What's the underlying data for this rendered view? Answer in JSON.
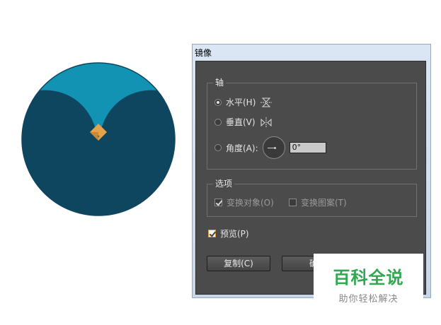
{
  "dialog": {
    "title": "镜像",
    "axis_group": {
      "label": "轴",
      "horizontal": "水平(H)",
      "vertical": "垂直(V)",
      "angle": "角度(A):",
      "angle_value": "0°",
      "selected": "horizontal"
    },
    "options_group": {
      "label": "选项",
      "transform_objects": "变换对象(O)",
      "transform_patterns": "变换图案(T)",
      "transform_objects_checked": true,
      "transform_patterns_checked": false
    },
    "preview_label": "预览(P)",
    "preview_checked": true,
    "copy_button": "复制(C)",
    "ok_button": "确"
  },
  "artwork": {
    "outer_circle_color": "#0e4660",
    "sky_color": "#1393b3",
    "diamond_color": "#e6a24a"
  },
  "watermark": {
    "brand": "百科全说",
    "tagline": "助你轻松解决"
  }
}
